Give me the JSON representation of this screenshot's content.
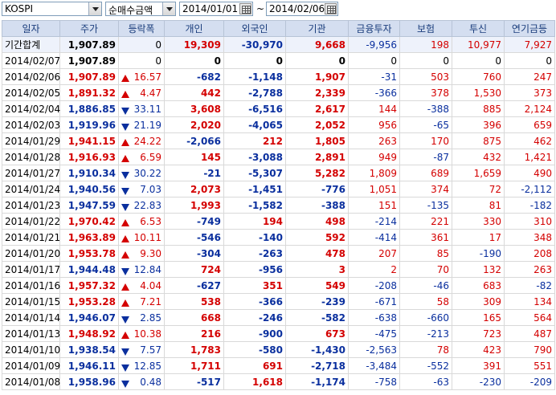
{
  "toolbar": {
    "market": "KOSPI",
    "metric": "순매수금액",
    "date_from": "2014/01/01",
    "date_to": "2014/02/06",
    "separator": "~"
  },
  "columns": [
    "일자",
    "주가",
    "등락폭",
    "개인",
    "외국인",
    "기관",
    "금융투자",
    "보험",
    "투신",
    "연기금등"
  ],
  "colors": {
    "up": "#d40000",
    "down": "#0a2f9e",
    "header_bg": "#d4def0"
  },
  "rows": [
    {
      "date": "기간합계",
      "price": "1,907.89",
      "dir": "",
      "chg": "0",
      "ind": "19,309",
      "frn": "-30,970",
      "inst": "9,668",
      "fin": "-9,956",
      "ins": "198",
      "trust": "10,977",
      "pen": "7,927",
      "total": true
    },
    {
      "date": "2014/02/07",
      "price": "1,907.89",
      "dir": "",
      "chg": "0",
      "ind": "0",
      "frn": "0",
      "inst": "0",
      "fin": "0",
      "ins": "0",
      "trust": "0",
      "pen": "0"
    },
    {
      "date": "2014/02/06",
      "price": "1,907.89",
      "dir": "up",
      "chg": "16.57",
      "ind": "-682",
      "frn": "-1,148",
      "inst": "1,907",
      "fin": "-31",
      "ins": "503",
      "trust": "760",
      "pen": "247"
    },
    {
      "date": "2014/02/05",
      "price": "1,891.32",
      "dir": "up",
      "chg": "4.47",
      "ind": "442",
      "frn": "-2,788",
      "inst": "2,339",
      "fin": "-366",
      "ins": "378",
      "trust": "1,530",
      "pen": "373"
    },
    {
      "date": "2014/02/04",
      "price": "1,886.85",
      "dir": "down",
      "chg": "33.11",
      "ind": "3,608",
      "frn": "-6,516",
      "inst": "2,617",
      "fin": "144",
      "ins": "-388",
      "trust": "885",
      "pen": "2,124"
    },
    {
      "date": "2014/02/03",
      "price": "1,919.96",
      "dir": "down",
      "chg": "21.19",
      "ind": "2,020",
      "frn": "-4,065",
      "inst": "2,052",
      "fin": "956",
      "ins": "-65",
      "trust": "396",
      "pen": "659"
    },
    {
      "date": "2014/01/29",
      "price": "1,941.15",
      "dir": "up",
      "chg": "24.22",
      "ind": "-2,066",
      "frn": "212",
      "inst": "1,805",
      "fin": "263",
      "ins": "170",
      "trust": "875",
      "pen": "462"
    },
    {
      "date": "2014/01/28",
      "price": "1,916.93",
      "dir": "up",
      "chg": "6.59",
      "ind": "145",
      "frn": "-3,088",
      "inst": "2,891",
      "fin": "949",
      "ins": "-87",
      "trust": "432",
      "pen": "1,421"
    },
    {
      "date": "2014/01/27",
      "price": "1,910.34",
      "dir": "down",
      "chg": "30.22",
      "ind": "-21",
      "frn": "-5,307",
      "inst": "5,282",
      "fin": "1,809",
      "ins": "689",
      "trust": "1,659",
      "pen": "490"
    },
    {
      "date": "2014/01/24",
      "price": "1,940.56",
      "dir": "down",
      "chg": "7.03",
      "ind": "2,073",
      "frn": "-1,451",
      "inst": "-776",
      "fin": "1,051",
      "ins": "374",
      "trust": "72",
      "pen": "-2,112"
    },
    {
      "date": "2014/01/23",
      "price": "1,947.59",
      "dir": "down",
      "chg": "22.83",
      "ind": "1,993",
      "frn": "-1,582",
      "inst": "-388",
      "fin": "151",
      "ins": "-135",
      "trust": "81",
      "pen": "-182"
    },
    {
      "date": "2014/01/22",
      "price": "1,970.42",
      "dir": "up",
      "chg": "6.53",
      "ind": "-749",
      "frn": "194",
      "inst": "498",
      "fin": "-214",
      "ins": "221",
      "trust": "330",
      "pen": "310"
    },
    {
      "date": "2014/01/21",
      "price": "1,963.89",
      "dir": "up",
      "chg": "10.11",
      "ind": "-546",
      "frn": "-140",
      "inst": "592",
      "fin": "-414",
      "ins": "361",
      "trust": "17",
      "pen": "348"
    },
    {
      "date": "2014/01/20",
      "price": "1,953.78",
      "dir": "up",
      "chg": "9.30",
      "ind": "-304",
      "frn": "-263",
      "inst": "478",
      "fin": "207",
      "ins": "85",
      "trust": "-190",
      "pen": "208"
    },
    {
      "date": "2014/01/17",
      "price": "1,944.48",
      "dir": "down",
      "chg": "12.84",
      "ind": "724",
      "frn": "-956",
      "inst": "3",
      "fin": "2",
      "ins": "70",
      "trust": "132",
      "pen": "263"
    },
    {
      "date": "2014/01/16",
      "price": "1,957.32",
      "dir": "up",
      "chg": "4.04",
      "ind": "-627",
      "frn": "351",
      "inst": "549",
      "fin": "-208",
      "ins": "-46",
      "trust": "683",
      "pen": "-82"
    },
    {
      "date": "2014/01/15",
      "price": "1,953.28",
      "dir": "up",
      "chg": "7.21",
      "ind": "538",
      "frn": "-366",
      "inst": "-239",
      "fin": "-671",
      "ins": "58",
      "trust": "309",
      "pen": "134"
    },
    {
      "date": "2014/01/14",
      "price": "1,946.07",
      "dir": "down",
      "chg": "2.85",
      "ind": "668",
      "frn": "-246",
      "inst": "-582",
      "fin": "-638",
      "ins": "-660",
      "trust": "165",
      "pen": "564"
    },
    {
      "date": "2014/01/13",
      "price": "1,948.92",
      "dir": "up",
      "chg": "10.38",
      "ind": "216",
      "frn": "-900",
      "inst": "673",
      "fin": "-475",
      "ins": "-213",
      "trust": "723",
      "pen": "487"
    },
    {
      "date": "2014/01/10",
      "price": "1,938.54",
      "dir": "down",
      "chg": "7.57",
      "ind": "1,783",
      "frn": "-580",
      "inst": "-1,430",
      "fin": "-2,563",
      "ins": "78",
      "trust": "423",
      "pen": "790"
    },
    {
      "date": "2014/01/09",
      "price": "1,946.11",
      "dir": "down",
      "chg": "12.85",
      "ind": "1,711",
      "frn": "691",
      "inst": "-2,718",
      "fin": "-3,484",
      "ins": "-552",
      "trust": "391",
      "pen": "551"
    },
    {
      "date": "2014/01/08",
      "price": "1,958.96",
      "dir": "down",
      "chg": "0.48",
      "ind": "-517",
      "frn": "1,618",
      "inst": "-1,174",
      "fin": "-758",
      "ins": "-63",
      "trust": "-230",
      "pen": "-209"
    }
  ]
}
